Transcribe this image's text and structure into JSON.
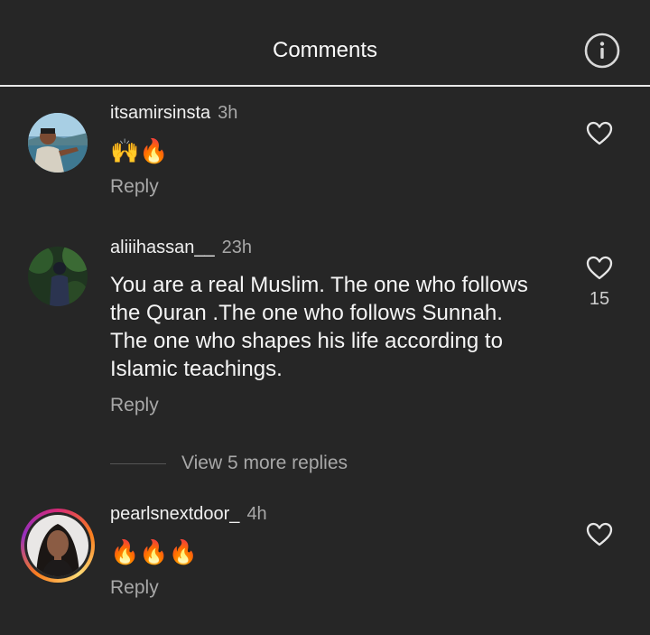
{
  "header": {
    "title": "Comments",
    "info_icon": "info-icon"
  },
  "comments": [
    {
      "username": "itsamirsinsta",
      "time": "3h",
      "text": "🙌🔥",
      "reply_label": "Reply",
      "like_count": ""
    },
    {
      "username": "aliiihassan__",
      "time": "23h",
      "text": "You  are a real Muslim.  The one who follows the Quran .The one who follows Sunnah.  The one who shapes his life according to Islamic teachings.",
      "reply_label": "Reply",
      "like_count": "15"
    },
    {
      "username": "pearlsnextdoor_",
      "time": "4h",
      "text": "🔥🔥🔥",
      "reply_label": "Reply",
      "like_count": ""
    }
  ],
  "view_more": {
    "label": "View 5 more replies"
  },
  "colors": {
    "background": "#262626",
    "secondary_text": "#a8a8a8",
    "divider": "#e8e8e8"
  }
}
